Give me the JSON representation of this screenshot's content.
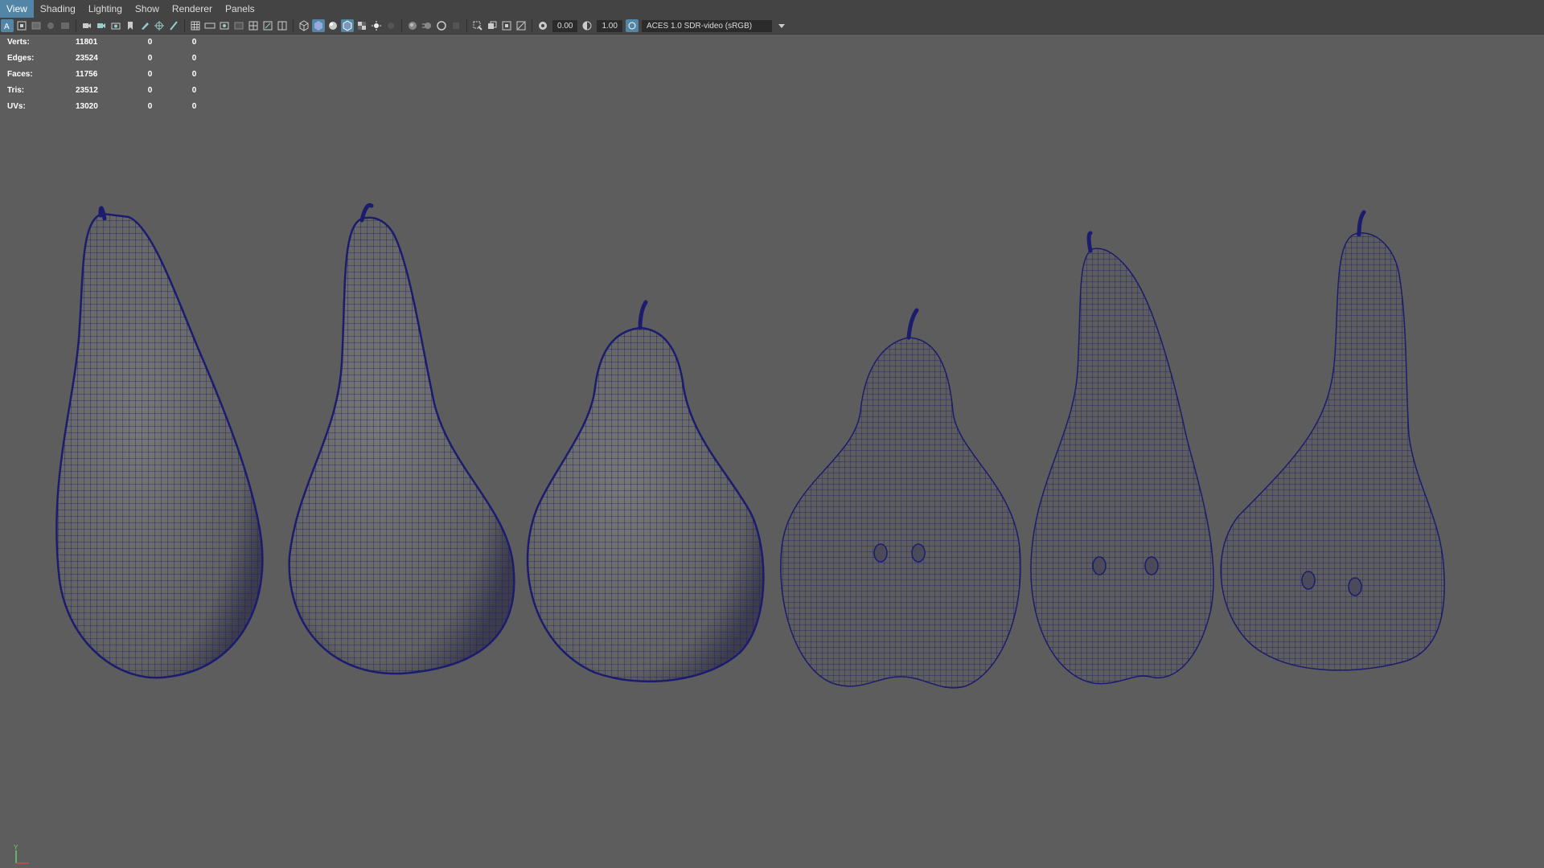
{
  "menu": [
    "View",
    "Shading",
    "Lighting",
    "Show",
    "Renderer",
    "Panels"
  ],
  "toolbar": {
    "exposure": "0.00",
    "gamma": "1.00",
    "color_space": "ACES 1.0 SDR-video (sRGB)"
  },
  "stats": [
    {
      "label": "Verts:",
      "v1": "11801",
      "v2": "0",
      "v3": "0"
    },
    {
      "label": "Edges:",
      "v1": "23524",
      "v2": "0",
      "v3": "0"
    },
    {
      "label": "Faces:",
      "v1": "11756",
      "v2": "0",
      "v3": "0"
    },
    {
      "label": "Tris:",
      "v1": "23512",
      "v2": "0",
      "v3": "0"
    },
    {
      "label": "UVs:",
      "v1": "13020",
      "v2": "0",
      "v3": "0"
    }
  ],
  "axis": {
    "y_label": "Y"
  },
  "colors": {
    "viewport": "#5d5d5d",
    "wire": "#1c1c6e",
    "highlight": "#5285a6",
    "pear_fill": "#6b6b6b"
  }
}
